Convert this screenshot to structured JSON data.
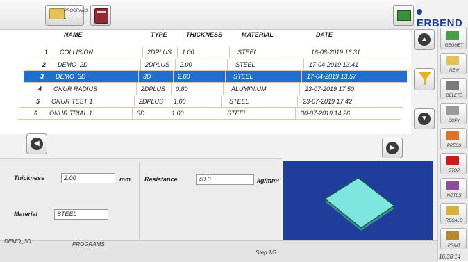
{
  "toolbar": {
    "programs_label": "PROGRAMS",
    "brand": "ERBEND"
  },
  "table": {
    "headers": {
      "name": "NAME",
      "type": "TYPE",
      "thickness": "THICKNESS",
      "material": "MATERIAL",
      "date": "DATE"
    },
    "rows": [
      {
        "num": "1",
        "name": "COLLISION",
        "type": "2DPLUS",
        "thickness": "1.00",
        "material": "STEEL",
        "date": "16-08-2019 16.31",
        "selected": false
      },
      {
        "num": "2",
        "name": "DEMO_2D",
        "type": "2DPLUS",
        "thickness": "2.00",
        "material": "STEEL",
        "date": "17-04-2019 13.41",
        "selected": false
      },
      {
        "num": "3",
        "name": "DEMO_3D",
        "type": "3D",
        "thickness": "2.00",
        "material": "STEEL",
        "date": "17-04-2019 13.57",
        "selected": true
      },
      {
        "num": "4",
        "name": "ONUR RADIUS",
        "type": "2DPLUS",
        "thickness": "0.80",
        "material": "ALUMINIUM",
        "date": "23-07-2019 17.50",
        "selected": false
      },
      {
        "num": "5",
        "name": "ONUR TEST 1",
        "type": "2DPLUS",
        "thickness": "1.00",
        "material": "STEEL",
        "date": "23-07-2019 17.42",
        "selected": false
      },
      {
        "num": "6",
        "name": "ONUR TRIAL 1",
        "type": "3D",
        "thickness": "1.00",
        "material": "STEEL",
        "date": "30-07-2019 14.26",
        "selected": false
      }
    ]
  },
  "side_actions": [
    {
      "label": "GEOMET",
      "color": "#4a9b4a"
    },
    {
      "label": "NEW",
      "color": "#e6c15a"
    },
    {
      "label": "DELETE",
      "color": "#7a7a7a"
    },
    {
      "label": "COPY",
      "color": "#9a9a9a"
    },
    {
      "label": "PRESS",
      "color": "#d9742a"
    },
    {
      "label": "STOP",
      "color": "#c81e1e"
    },
    {
      "label": "NOTES",
      "color": "#8a4f9b"
    },
    {
      "label": "RECALC",
      "color": "#d8b13a"
    },
    {
      "label": "PRINT",
      "color": "#b58a2e"
    }
  ],
  "form": {
    "thickness_label": "Thickness",
    "thickness_value": "2.00",
    "thickness_unit": "mm",
    "resistance_label": "Resistance",
    "resistance_value": "40.0",
    "resistance_unit": "kg/mm²",
    "material_label": "Material",
    "material_value": "STEEL"
  },
  "status": {
    "program": "DEMO_3D",
    "section": "PROGRAMS",
    "step": "Step 1/8",
    "time": "16:36:14"
  },
  "colors": {
    "selection": "#1e6fcf",
    "preview_bg": "#1f3d9a",
    "part": "#7fe6de"
  }
}
